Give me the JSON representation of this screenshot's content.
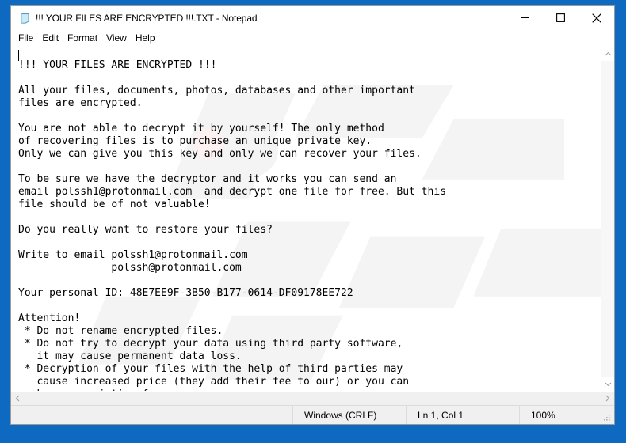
{
  "window": {
    "title": "!!! YOUR FILES ARE ENCRYPTED !!!.TXT - Notepad",
    "icon": "notepad-icon",
    "controls": {
      "minimize": "minimize-icon",
      "maximize": "maximize-icon",
      "close": "close-icon"
    },
    "border_color": "#0e69c0"
  },
  "menubar": {
    "items": [
      {
        "label": "File"
      },
      {
        "label": "Edit"
      },
      {
        "label": "Format"
      },
      {
        "label": "View"
      },
      {
        "label": "Help"
      }
    ]
  },
  "document": {
    "body": "!!! YOUR FILES ARE ENCRYPTED !!!\n\nAll your files, documents, photos, databases and other important\nfiles are encrypted.\n\nYou are not able to decrypt it by yourself! The only method\nof recovering files is to purchase an unique private key.\nOnly we can give you this key and only we can recover your files.\n\nTo be sure we have the decryptor and it works you can send an\nemail polssh1@protonmail.com  and decrypt one file for free. But this\nfile should be of not valuable!\n\nDo you really want to restore your files?\n\nWrite to email polssh1@protonmail.com\n               polssh@protonmail.com\n\nYour personal ID: 48E7EE9F-3B50-B177-0614-DF09178EE722\n\nAttention!\n * Do not rename encrypted files.\n * Do not try to decrypt your data using third party software,\n   it may cause permanent data loss.\n * Decryption of your files with the help of third parties may\n   cause increased price (they add their fee to our) or you can\n   become a victim of a scam.",
    "personal_id": "48E7EE9F-3B50-B177-0614-DF09178EE722",
    "emails": [
      "polssh1@protonmail.com",
      "polssh@protonmail.com"
    ]
  },
  "scrollbars": {
    "vertical": {
      "up": "chevron-up-icon",
      "down": "chevron-down-icon"
    },
    "horizontal": {
      "left": "chevron-left-icon",
      "right": "chevron-right-icon"
    }
  },
  "statusbar": {
    "line_ending": "Windows (CRLF)",
    "cursor_position": "Ln 1, Col 1",
    "zoom": "100%"
  }
}
